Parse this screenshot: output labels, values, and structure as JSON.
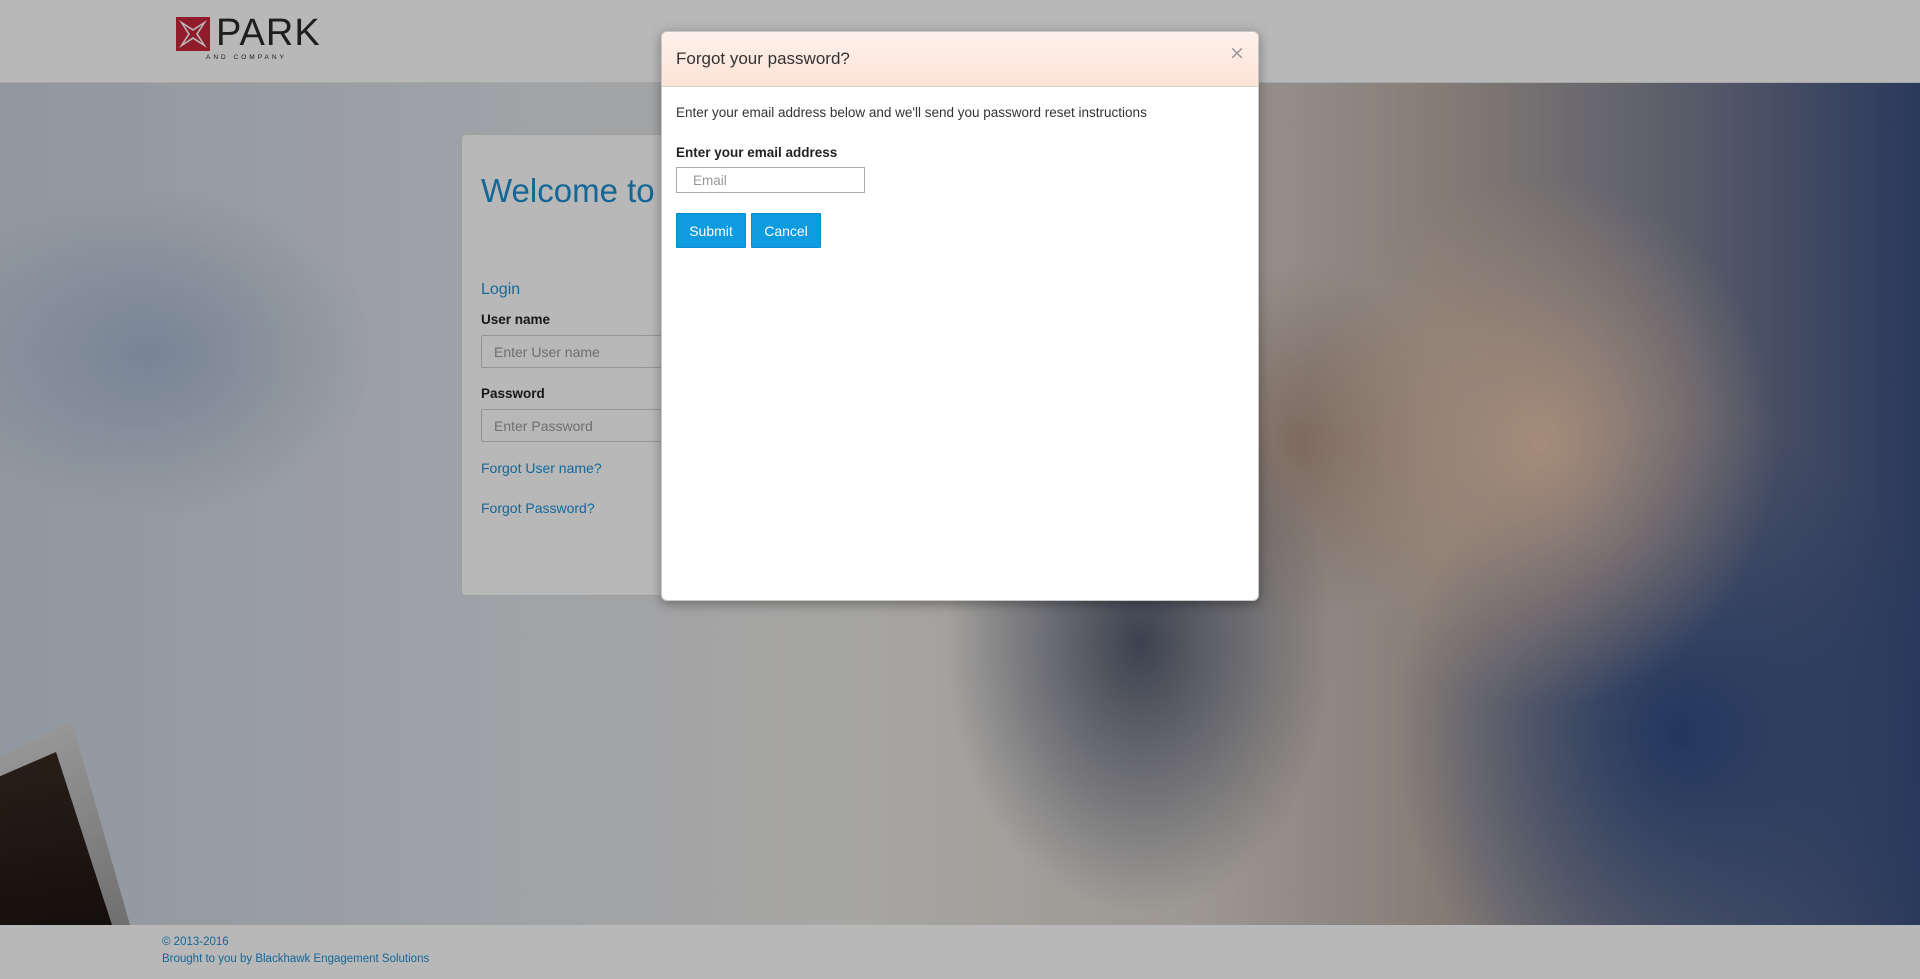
{
  "header": {
    "logo_word": "PARK",
    "logo_subtitle": "AND COMPANY"
  },
  "login": {
    "welcome": "Welcome to Park & Company",
    "login_link": "Login",
    "username_label": "User name",
    "username_placeholder": "Enter User name",
    "password_label": "Password",
    "password_placeholder": "Enter Password",
    "forgot_username": "Forgot User name?",
    "forgot_password": "Forgot Password?"
  },
  "modal": {
    "title": "Forgot your password?",
    "close_glyph": "×",
    "description": "Enter your email address below and we'll send you password reset instructions",
    "email_label": "Enter your email address",
    "email_placeholder": "Email",
    "submit_label": "Submit",
    "cancel_label": "Cancel"
  },
  "footer": {
    "copyright": "© 2013-2016",
    "credit": "Brought to you by Blackhawk Engagement Solutions"
  },
  "colors": {
    "accent_blue": "#1e8fd3",
    "button_blue": "#0e9be0",
    "modal_header": "#fde3d6",
    "logo_red": "#c8283c"
  },
  "icons": {
    "logo_mark": "maltese-cross-icon",
    "close": "close-icon"
  }
}
